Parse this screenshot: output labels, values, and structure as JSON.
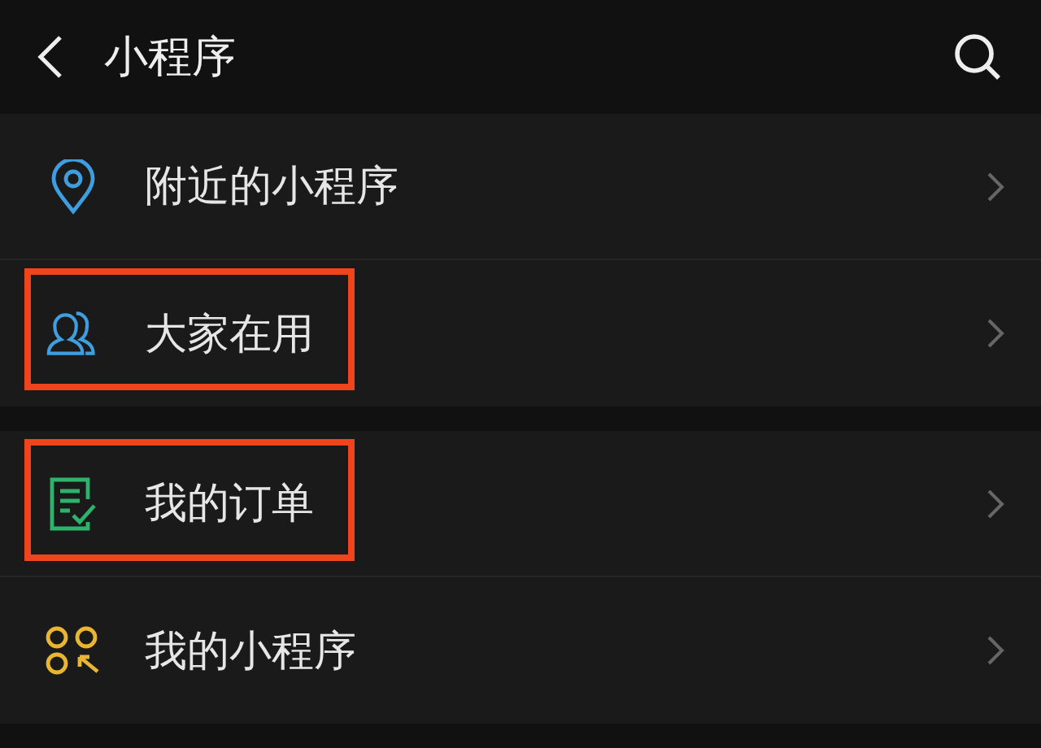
{
  "header": {
    "title": "小程序"
  },
  "groups": [
    {
      "items": [
        {
          "label": "附近的小程序",
          "kind": "location",
          "highlighted": false
        },
        {
          "label": "大家在用",
          "kind": "people",
          "highlighted": true
        }
      ]
    },
    {
      "items": [
        {
          "label": "我的订单",
          "kind": "order",
          "highlighted": true
        },
        {
          "label": "我的小程序",
          "kind": "apps",
          "highlighted": false
        }
      ]
    }
  ]
}
